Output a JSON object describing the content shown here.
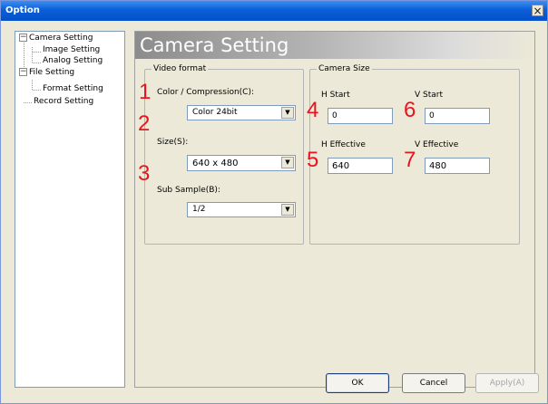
{
  "window": {
    "title": "Option",
    "close_glyph": "×"
  },
  "tree": {
    "items": [
      {
        "label": "Camera Setting",
        "toggle": "−"
      },
      {
        "label": "Image Setting"
      },
      {
        "label": "Analog Setting"
      },
      {
        "label": "File Setting",
        "toggle": "−"
      },
      {
        "label": "Format Setting"
      },
      {
        "label": "Record Setting"
      }
    ]
  },
  "page": {
    "title": "Camera Setting"
  },
  "video_format": {
    "group_label": "Video format",
    "color_label": "Color / Compression(C):",
    "color_value": "Color 24bit",
    "size_label": "Size(S):",
    "size_value": "640 x 480",
    "subsample_label": "Sub Sample(B):",
    "subsample_value": "1/2"
  },
  "camera_size": {
    "group_label": "Camera Size",
    "h_start_label": "H Start",
    "h_start_value": "0",
    "v_start_label": "V Start",
    "v_start_value": "0",
    "h_effective_label": "H Effective",
    "h_effective_value": "640",
    "v_effective_label": "V Effective",
    "v_effective_value": "480"
  },
  "annotations": [
    "1",
    "2",
    "3",
    "4",
    "5",
    "6",
    "7"
  ],
  "buttons": {
    "ok": "OK",
    "cancel": "Cancel",
    "apply": "Apply(A)"
  },
  "icons": {
    "dropdown": "▼"
  },
  "colors": {
    "titlebar": "#0a5fd8",
    "annotation": "#e8141e",
    "banner": "#8c8c8c"
  }
}
